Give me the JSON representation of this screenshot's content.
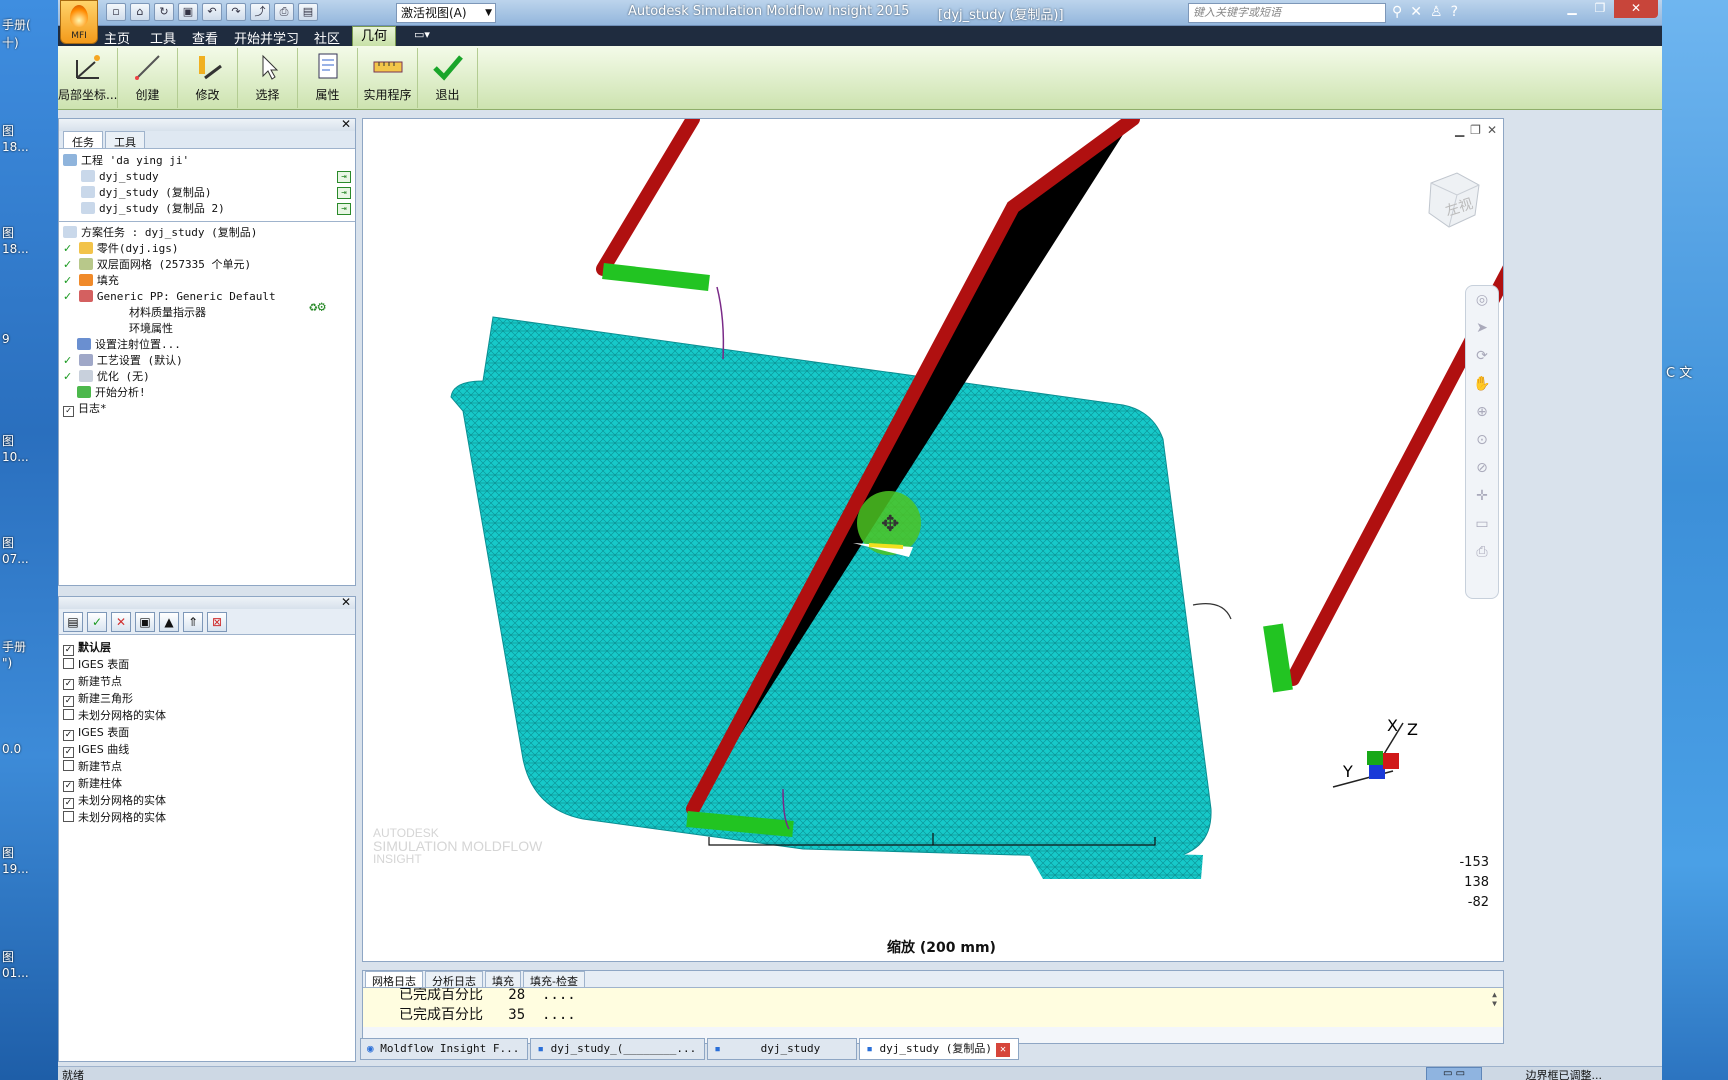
{
  "desktop": {
    "left_labels": [
      "手册(",
      "十)",
      "图",
      "18...",
      "图",
      "18...",
      "9",
      "图",
      "10...",
      "图",
      "07...",
      "手册",
      "\")",
      "0.0",
      "图",
      "19...",
      "图",
      "01..."
    ],
    "right_label": "C 文"
  },
  "titlebar": {
    "app_button_label": "MFI",
    "view_dropdown": "激活视图(A)",
    "title": "Autodesk Simulation Moldflow Insight 2015",
    "document": "[dyj_study (复制品)]",
    "search_placeholder": "键入关键字或短语"
  },
  "menu": {
    "tabs": [
      "主页",
      "工具",
      "查看",
      "开始并学习",
      "社区",
      "几何"
    ],
    "active": "几何"
  },
  "ribbon": {
    "buttons": [
      "局部坐标...",
      "创建",
      "修改",
      "选择",
      "属性",
      "实用程序",
      "退出"
    ]
  },
  "task_panel": {
    "tabs": [
      "任务",
      "工具"
    ],
    "project": "工程 'da ying ji'",
    "studies": [
      "dyj_study",
      "dyj_study (复制品)",
      "dyj_study (复制品 2)"
    ],
    "study_tasks_title": "方案任务 : dyj_study (复制品)",
    "tasks": [
      {
        "label": "零件(dyj.igs)",
        "checked": true
      },
      {
        "label": "双层面网格 (257335 个单元)",
        "checked": true
      },
      {
        "label": "填充",
        "checked": true
      },
      {
        "label": "Generic PP: Generic Default",
        "checked": true
      },
      {
        "label": "材料质量指示器",
        "checked": false
      },
      {
        "label": "环境属性",
        "checked": false
      },
      {
        "label": "设置注射位置...",
        "checked": false
      },
      {
        "label": "工艺设置 (默认)",
        "checked": true
      },
      {
        "label": "优化 (无)",
        "checked": true
      },
      {
        "label": "开始分析!",
        "checked": false
      },
      {
        "label": "日志*",
        "checked": true
      }
    ]
  },
  "layers_panel": {
    "items": [
      {
        "label": "默认层",
        "checked": true,
        "bold": true
      },
      {
        "label": "IGES 表面",
        "checked": false
      },
      {
        "label": "新建节点",
        "checked": true
      },
      {
        "label": "新建三角形",
        "checked": true
      },
      {
        "label": "未划分网格的实体",
        "checked": false
      },
      {
        "label": "IGES 表面",
        "checked": true
      },
      {
        "label": "IGES 曲线",
        "checked": true
      },
      {
        "label": "新建节点",
        "checked": false
      },
      {
        "label": "新建柱体",
        "checked": true
      },
      {
        "label": "未划分网格的实体",
        "checked": true
      },
      {
        "label": "未划分网格的实体",
        "checked": false
      }
    ]
  },
  "viewport": {
    "watermark": [
      "AUTODESK",
      "SIMULATION MOLDFLOW",
      "INSIGHT"
    ],
    "scale_label": "缩放 (200 mm)",
    "coords": [
      "-153",
      "138",
      "-82"
    ],
    "axis_labels": [
      "X",
      "Z",
      "Y"
    ],
    "viewcube_face": "左视"
  },
  "log": {
    "tabs": [
      "网格日志",
      "分析日志",
      "填充",
      "填充-检查"
    ],
    "lines": [
      "已完成百分比   28  ....",
      "已完成百分比   35  ...."
    ]
  },
  "doc_tabs": [
    "Moldflow Insight F...",
    "dyj_study_(________...",
    "dyj_study",
    "dyj_study (复制品)"
  ],
  "statusbar": {
    "left": "就绪",
    "right": "边界框已调整..."
  },
  "colors": {
    "mesh": "#14c8c8",
    "runner": "#b01010",
    "cooling": "#22c422",
    "ribbon_active": "#c7e0a6"
  }
}
